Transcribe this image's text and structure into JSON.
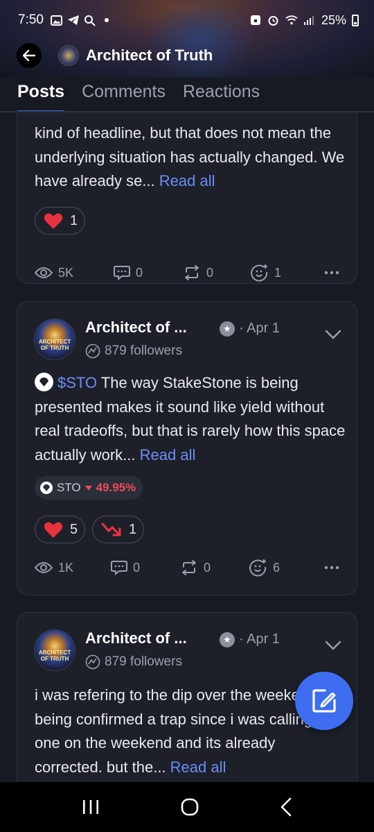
{
  "status_bar": {
    "time": "7:50",
    "battery": "25%"
  },
  "header": {
    "title": "Architect of Truth"
  },
  "tabs": [
    {
      "label": "Posts",
      "active": true
    },
    {
      "label": "Comments",
      "active": false
    },
    {
      "label": "Reactions",
      "active": false
    }
  ],
  "posts": [
    {
      "body": "kind of headline, but that does not mean the underlying situation has actually changed. We have already se...",
      "read_all": "Read all",
      "reactions": [
        {
          "icon": "heart-icon",
          "count": "1"
        }
      ],
      "stats": {
        "views": "5K",
        "comments": "0",
        "reposts": "0",
        "reacts": "1"
      }
    },
    {
      "author": "Architect of ...",
      "date": "· Apr 1",
      "followers": "879 followers",
      "avatar_text": "ARCHITECT OF TRUTH",
      "ticker": "$STO",
      "body": " The way StakeStone is being presented makes it sound like yield without real tradeoffs, but that is rarely how this space actually work...",
      "read_all": "Read all",
      "token": {
        "symbol": "STO",
        "change": "49.95%"
      },
      "reactions": [
        {
          "icon": "heart-icon",
          "count": "5"
        },
        {
          "icon": "bearish-icon",
          "count": "1"
        }
      ],
      "stats": {
        "views": "1K",
        "comments": "0",
        "reposts": "0",
        "reacts": "6"
      }
    },
    {
      "author": "Architect of ...",
      "date": "· Apr 1",
      "followers": "879 followers",
      "avatar_text": "ARCHITECT OF TRUTH",
      "body": "i was refering to the dip over the weekend being confirmed a trap since i was calling it one on the weekend and its already corrected. but the...",
      "read_all": "Read all"
    }
  ],
  "colors": {
    "accent": "#3e6df0",
    "link": "#6b8ef7",
    "negative": "#ef4b57",
    "heart": "#e8323c"
  }
}
